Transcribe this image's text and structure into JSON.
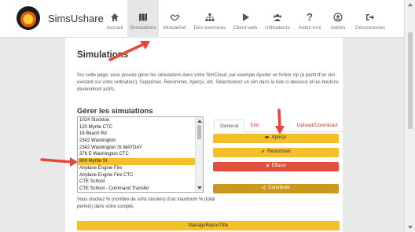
{
  "brand": "SimsUshare",
  "nav": [
    {
      "label": "Accueil",
      "icon": "home-icon"
    },
    {
      "label": "Simulations",
      "icon": "map-icon"
    },
    {
      "label": "MutualAid",
      "icon": "handshake-icon"
    },
    {
      "label": "Des exercices",
      "icon": "sitemap-icon"
    },
    {
      "label": "Client web",
      "icon": "play-icon"
    },
    {
      "label": "Utilisateurs",
      "icon": "users-icon"
    },
    {
      "label": "Aidez-moi",
      "icon": "question-icon"
    },
    {
      "label": "Admin",
      "icon": "user-circle-icon"
    },
    {
      "label": "Déconnexion",
      "icon": "sign-out-icon"
    }
  ],
  "page": {
    "title": "Simulations",
    "description": "Sur cette page, vous pouvez gérer les simulations dans votre SimCloud, par exemple Ajouter un fichier zip (à partir d'un sim existant sur votre ordinateur), Supprimer, Renommer, Aperçu, etc. Sélectionnez un sim dans la liste ci-dessous et les boutons deviendront actifs.",
    "manage_title": "Gérer les simulations",
    "quota": "Vous stockez % (nombre de sims stockés) d'un maximum % (total permis) dans votre compte.",
    "bottom_button": "ManageReposTitle"
  },
  "simulations": [
    "1024 Stockton",
    "120 Myrtle CTC",
    "18 Beach Rd",
    "2342 Washington",
    "2342 Washington St MAYDAY",
    "376 E Washington CTC",
    "800 Myrtle St",
    "Airplane Engine Fire",
    "Airplane Engine Fire CTC",
    "CTE School",
    "CTE School - Command Transfer",
    "CTE School CTC"
  ],
  "selected_simulation": "800 Myrtle St",
  "tabs": [
    {
      "label": "General",
      "active": true
    },
    {
      "label": "Sim Embedding",
      "active": false
    },
    {
      "label": "Upload/Download",
      "active": false
    }
  ],
  "actions": {
    "preview": "Aperçu",
    "rename": "Renommer",
    "delete": "Effacer",
    "contribute": "Contribute"
  },
  "colors": {
    "accent": "#f3c02c",
    "danger": "#e04e3d",
    "gold": "#c89a1c",
    "annotation_arrow": "#e8463a"
  }
}
